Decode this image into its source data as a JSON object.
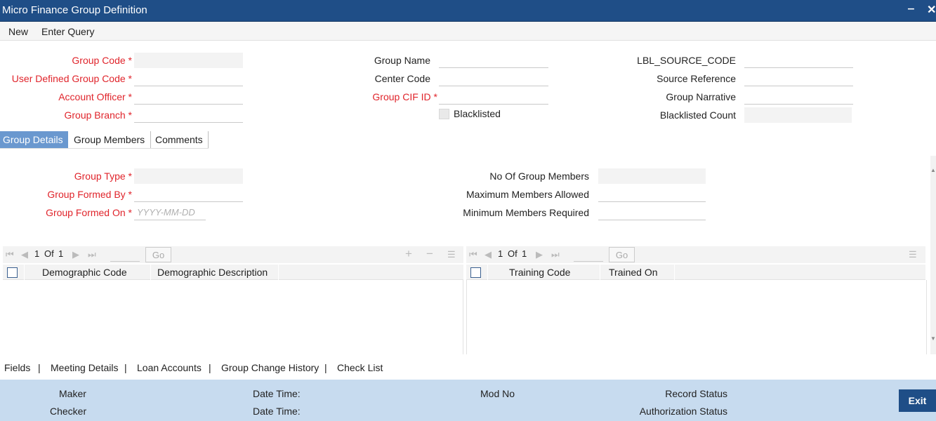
{
  "window": {
    "title": "Micro Finance Group Definition",
    "minimize": "‒",
    "close": "✕"
  },
  "menu": {
    "new": "New",
    "enter_query": "Enter Query"
  },
  "header": {
    "group_code": "Group Code *",
    "user_defined_group_code": "User Defined Group Code *",
    "account_officer": "Account Officer *",
    "group_branch": "Group Branch *",
    "group_name": "Group Name",
    "center_code": "Center Code",
    "group_cif_id": "Group CIF ID *",
    "blacklisted": "Blacklisted",
    "source_code": "LBL_SOURCE_CODE",
    "source_reference": "Source Reference",
    "group_narrative": "Group Narrative",
    "blacklisted_count": "Blacklisted Count"
  },
  "tabs": [
    {
      "label": "Group Details",
      "active": true
    },
    {
      "label": "Group Members",
      "active": false
    },
    {
      "label": "Comments",
      "active": false
    }
  ],
  "group_details": {
    "group_type": "Group Type *",
    "group_formed_by": "Group Formed By *",
    "group_formed_on": "Group Formed On *",
    "date_placeholder": "YYYY-MM-DD",
    "no_of_group_members": "No Of Group Members",
    "maximum_members_allowed": "Maximum Members Allowed",
    "minimum_members_required": "Minimum Members Required"
  },
  "demographic_grid": {
    "page": "1",
    "of": "Of",
    "total": "1",
    "go": "Go",
    "columns": [
      "Demographic Code",
      "Demographic Description"
    ]
  },
  "training_grid": {
    "page": "1",
    "of": "Of",
    "total": "1",
    "go": "Go",
    "columns": [
      "Training Code",
      "Trained On"
    ]
  },
  "bottom_links": [
    "Fields",
    "Meeting Details",
    "Loan Accounts",
    "Group Change History",
    "Check List"
  ],
  "footer": {
    "maker": "Maker",
    "checker": "Checker",
    "date_time_1": "Date Time:",
    "date_time_2": "Date Time:",
    "mod_no": "Mod No",
    "record_status": "Record Status",
    "authorization_status": "Authorization Status",
    "exit": "Exit"
  },
  "icons": {
    "first": "⏮",
    "prev": "◀",
    "next": "▶",
    "last": "⏭",
    "add": "+",
    "remove": "−",
    "columns": "☰"
  }
}
